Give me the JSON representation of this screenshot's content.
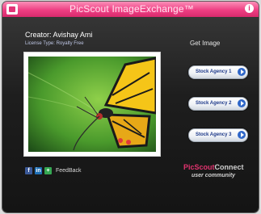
{
  "window": {
    "title": "PicScout ImageExchange™",
    "close_icon": "i"
  },
  "info": {
    "creator": "Creator: Avishay Ami",
    "license": "License Type: Royalty Free"
  },
  "get_image": {
    "heading": "Get Image",
    "agencies": [
      {
        "label": "Stock Agency 1"
      },
      {
        "label": "Stock Agency 2"
      },
      {
        "label": "Stock Agency 3"
      }
    ]
  },
  "footer": {
    "social": [
      {
        "icon": "facebook-icon",
        "glyph": "f",
        "color": "#3b5998"
      },
      {
        "icon": "linkedin-icon",
        "glyph": "in",
        "color": "#1f6fb5"
      },
      {
        "icon": "plus-icon",
        "glyph": "+",
        "color": "#35a853"
      }
    ],
    "feedback": "FeedBack",
    "brand_part1": "PicScout",
    "brand_part2": "Connect",
    "brand_sub": "user community"
  },
  "colors": {
    "accent": "#e23478",
    "button_text": "#1e3a8a"
  }
}
